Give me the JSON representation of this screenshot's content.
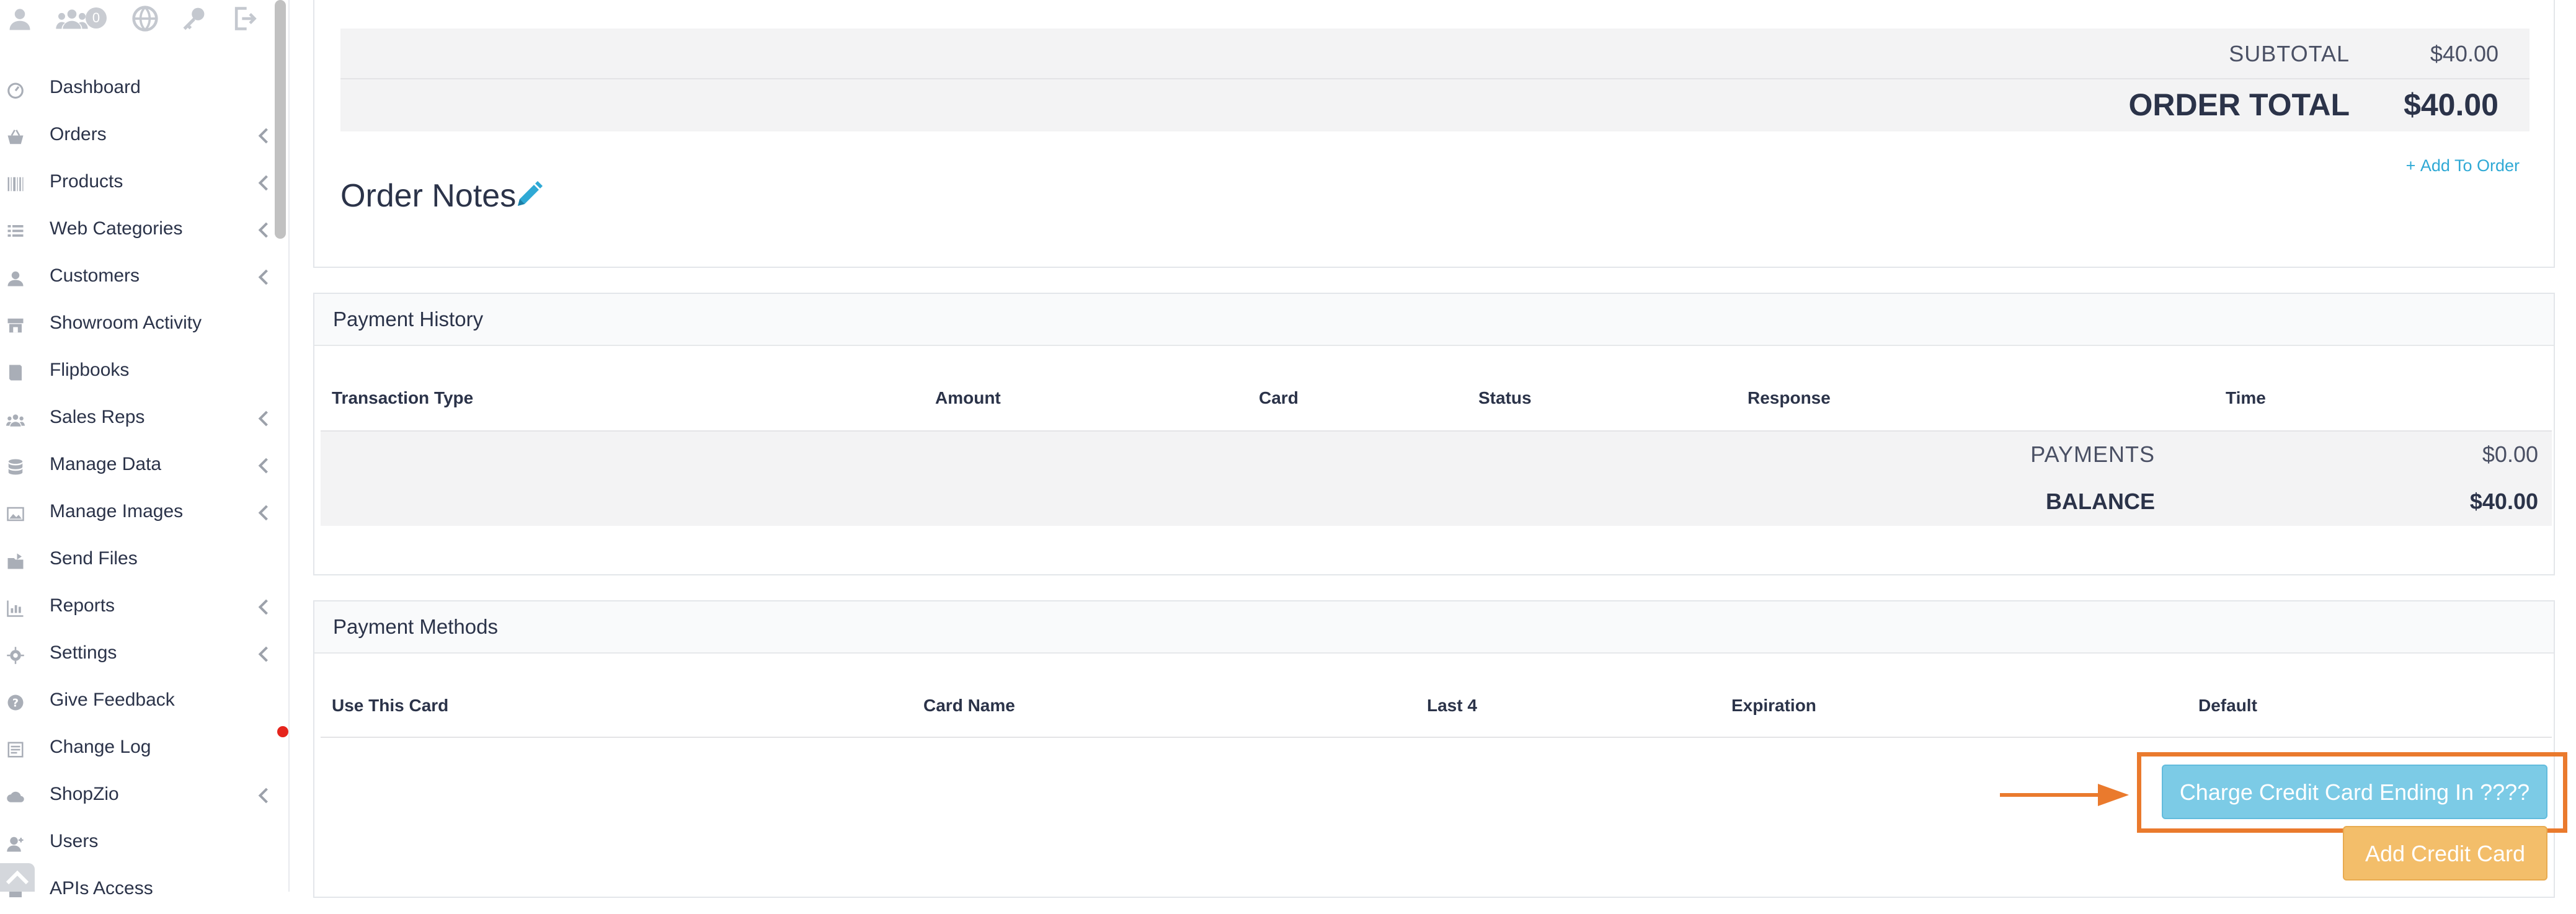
{
  "sidebar": {
    "top_icons": [
      "user-icon",
      "users-icon",
      "globe-icon",
      "key-icon",
      "sign-out-icon"
    ],
    "users_badge": "0",
    "items": [
      {
        "label": "Dashboard",
        "icon": "speedometer-icon",
        "chevron": false
      },
      {
        "label": "Orders",
        "icon": "basket-icon",
        "chevron": true
      },
      {
        "label": "Products",
        "icon": "barcode-icon",
        "chevron": true
      },
      {
        "label": "Web Categories",
        "icon": "list-icon",
        "chevron": true
      },
      {
        "label": "Customers",
        "icon": "user-icon",
        "chevron": true
      },
      {
        "label": "Showroom Activity",
        "icon": "store-icon",
        "chevron": false
      },
      {
        "label": "Flipbooks",
        "icon": "book-icon",
        "chevron": false
      },
      {
        "label": "Sales Reps",
        "icon": "users-icon",
        "chevron": true
      },
      {
        "label": "Manage Data",
        "icon": "database-icon",
        "chevron": true
      },
      {
        "label": "Manage Images",
        "icon": "image-icon",
        "chevron": true
      },
      {
        "label": "Send Files",
        "icon": "send-files-icon",
        "chevron": false
      },
      {
        "label": "Reports",
        "icon": "chart-icon",
        "chevron": true
      },
      {
        "label": "Settings",
        "icon": "gear-icon",
        "chevron": true
      },
      {
        "label": "Give Feedback",
        "icon": "question-icon",
        "chevron": false
      },
      {
        "label": "Change Log",
        "icon": "log-icon",
        "chevron": false
      },
      {
        "label": "ShopZio",
        "icon": "cloud-icon",
        "chevron": true
      },
      {
        "label": "Users",
        "icon": "user-add-icon",
        "chevron": false
      },
      {
        "label": "APIs Access",
        "icon": "api-icon",
        "chevron": false
      }
    ]
  },
  "order": {
    "subtotal_label": "SUBTOTAL",
    "subtotal_value": "$40.00",
    "total_label": "ORDER TOTAL",
    "total_value": "$40.00",
    "add_to_order": "Add To Order",
    "notes_title": "Order Notes"
  },
  "payment_history": {
    "title": "Payment History",
    "columns": [
      "Transaction Type",
      "Amount",
      "Card",
      "Status",
      "Response",
      "Time"
    ],
    "payments_label": "PAYMENTS",
    "payments_value": "$0.00",
    "balance_label": "BALANCE",
    "balance_value": "$40.00"
  },
  "payment_methods": {
    "title": "Payment Methods",
    "columns": [
      "Use This Card",
      "Card Name",
      "Last 4",
      "Expiration",
      "Default"
    ],
    "charge_button": "Charge Credit Card Ending In ????",
    "add_card_button": "Add Credit Card"
  },
  "colors": {
    "accent_blue": "#2fa9d5",
    "charge_button": "#7ccbe6",
    "add_card_button": "#f3be6a",
    "highlight": "#ea7a2d",
    "notification_dot": "#e5241c"
  }
}
